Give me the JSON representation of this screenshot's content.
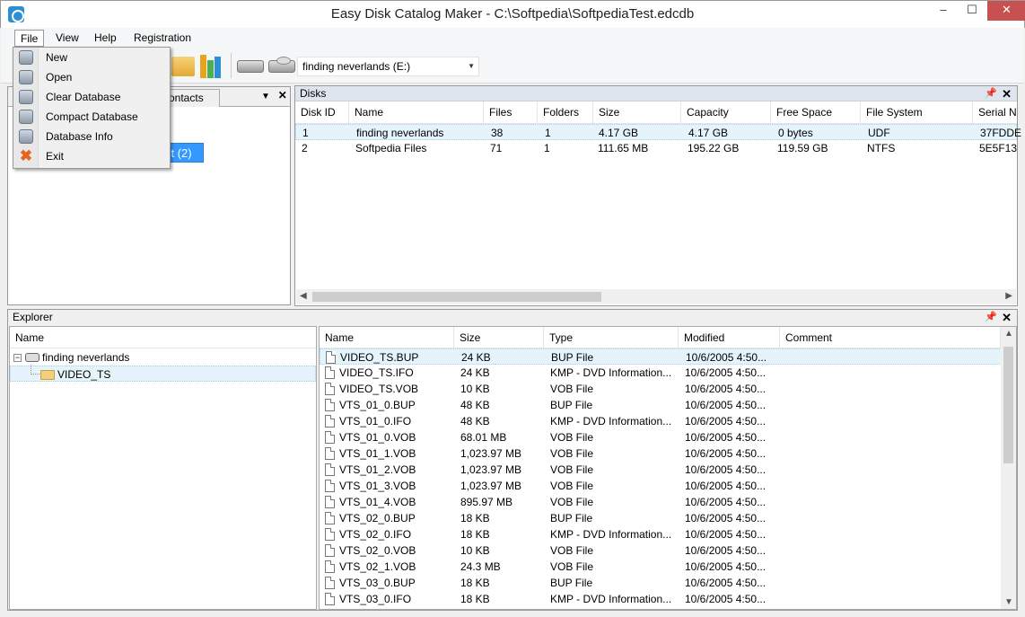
{
  "window": {
    "title": "Easy Disk Catalog Maker - C:\\Softpedia\\SoftpediaTest.edcdb",
    "minimize": "–",
    "maximize": "☐",
    "close": "✕"
  },
  "menubar": {
    "items": [
      "File",
      "View",
      "Help",
      "Registration"
    ]
  },
  "file_menu": {
    "items": [
      {
        "label": "New",
        "icon": "database-new-icon"
      },
      {
        "label": "Open",
        "icon": "database-open-icon"
      },
      {
        "label": "Clear Database",
        "icon": "database-clear-icon"
      },
      {
        "label": "Compact Database",
        "icon": "database-compact-icon"
      },
      {
        "label": "Database Info",
        "icon": "database-info-icon"
      },
      {
        "label": "Exit",
        "icon": "exit-icon"
      }
    ]
  },
  "toolbar": {
    "drive_combo_value": "finding neverlands (E:)"
  },
  "left_panel": {
    "tab_label": "ontacts",
    "selected_item": "st (2)"
  },
  "disks_panel": {
    "title": "Disks",
    "columns": [
      "Disk ID",
      "Name",
      "Files",
      "Folders",
      "Size",
      "Capacity",
      "Free Space",
      "File System",
      "Serial N"
    ],
    "rows": [
      [
        "1",
        "finding neverlands",
        "38",
        "1",
        "4.17 GB",
        "4.17 GB",
        "0 bytes",
        "UDF",
        "37FDDE"
      ],
      [
        "2",
        "Softpedia Files",
        "71",
        "1",
        "111.65 MB",
        "195.22 GB",
        "119.59 GB",
        "NTFS",
        "5E5F13"
      ]
    ]
  },
  "explorer": {
    "title": "Explorer",
    "tree_header": "Name",
    "tree": {
      "root": "finding neverlands",
      "child": "VIDEO_TS"
    },
    "columns": [
      "Name",
      "Size",
      "Type",
      "Modified",
      "Comment"
    ],
    "files": [
      [
        "VIDEO_TS.BUP",
        "24 KB",
        "BUP File",
        "10/6/2005 4:50..."
      ],
      [
        "VIDEO_TS.IFO",
        "24 KB",
        "KMP - DVD Information...",
        "10/6/2005 4:50..."
      ],
      [
        "VIDEO_TS.VOB",
        "10 KB",
        "VOB File",
        "10/6/2005 4:50..."
      ],
      [
        "VTS_01_0.BUP",
        "48 KB",
        "BUP File",
        "10/6/2005 4:50..."
      ],
      [
        "VTS_01_0.IFO",
        "48 KB",
        "KMP - DVD Information...",
        "10/6/2005 4:50..."
      ],
      [
        "VTS_01_0.VOB",
        "68.01 MB",
        "VOB File",
        "10/6/2005 4:50..."
      ],
      [
        "VTS_01_1.VOB",
        "1,023.97 MB",
        "VOB File",
        "10/6/2005 4:50..."
      ],
      [
        "VTS_01_2.VOB",
        "1,023.97 MB",
        "VOB File",
        "10/6/2005 4:50..."
      ],
      [
        "VTS_01_3.VOB",
        "1,023.97 MB",
        "VOB File",
        "10/6/2005 4:50..."
      ],
      [
        "VTS_01_4.VOB",
        "895.97 MB",
        "VOB File",
        "10/6/2005 4:50..."
      ],
      [
        "VTS_02_0.BUP",
        "18 KB",
        "BUP File",
        "10/6/2005 4:50..."
      ],
      [
        "VTS_02_0.IFO",
        "18 KB",
        "KMP - DVD Information...",
        "10/6/2005 4:50..."
      ],
      [
        "VTS_02_0.VOB",
        "10 KB",
        "VOB File",
        "10/6/2005 4:50..."
      ],
      [
        "VTS_02_1.VOB",
        "24.3 MB",
        "VOB File",
        "10/6/2005 4:50..."
      ],
      [
        "VTS_03_0.BUP",
        "18 KB",
        "BUP File",
        "10/6/2005 4:50..."
      ],
      [
        "VTS_03_0.IFO",
        "18 KB",
        "KMP - DVD Information...",
        "10/6/2005 4:50..."
      ]
    ]
  },
  "colors": {
    "selection": "#3399ff",
    "row_highlight": "#e5f3fb",
    "close_button": "#c75050"
  }
}
